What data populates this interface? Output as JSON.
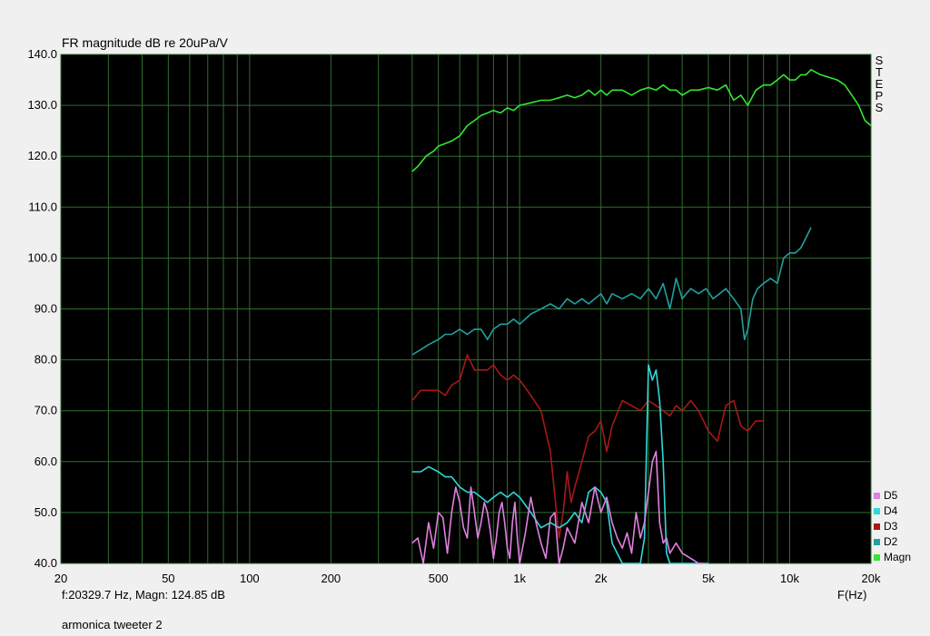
{
  "window": {
    "background": "#f0f0f0"
  },
  "header": {
    "steps_text": "STEPS"
  },
  "status": {
    "cursor_readout": "f:20329.7 Hz, Magn: 124.85 dB",
    "footer_label": "armonica tweeter 2"
  },
  "chart_data": {
    "type": "line",
    "title": "FR magnitude dB re 20uPa/V",
    "xlabel": "F(Hz)",
    "ylabel": "",
    "x_scale": "log",
    "xlim": [
      20,
      20000
    ],
    "ylim": [
      40,
      140
    ],
    "grid": true,
    "legend_placement": "bottom-right",
    "colors": {
      "plot_bg": "#000000",
      "grid": "#2f6e2f",
      "frame": "#3a7a3a"
    },
    "x_ticks": [
      {
        "v": 20,
        "label": "20"
      },
      {
        "v": 50,
        "label": "50"
      },
      {
        "v": 100,
        "label": "100"
      },
      {
        "v": 200,
        "label": "200"
      },
      {
        "v": 500,
        "label": "500"
      },
      {
        "v": 1000,
        "label": "1k"
      },
      {
        "v": 2000,
        "label": "2k"
      },
      {
        "v": 5000,
        "label": "5k"
      },
      {
        "v": 10000,
        "label": "10k"
      },
      {
        "v": 20000,
        "label": "20k"
      }
    ],
    "y_ticks": [
      {
        "v": 140,
        "label": "140.0"
      },
      {
        "v": 130,
        "label": "130.0"
      },
      {
        "v": 120,
        "label": "120.0"
      },
      {
        "v": 110,
        "label": "110.0"
      },
      {
        "v": 100,
        "label": "100.0"
      },
      {
        "v": 90,
        "label": "90.0"
      },
      {
        "v": 80,
        "label": "80.0"
      },
      {
        "v": 70,
        "label": "70.0"
      },
      {
        "v": 60,
        "label": "60.0"
      },
      {
        "v": 50,
        "label": "50.0"
      },
      {
        "v": 40,
        "label": "40.0"
      }
    ],
    "series": [
      {
        "name": "Magn",
        "color": "#33e633",
        "x": [
          400,
          420,
          450,
          480,
          500,
          530,
          560,
          600,
          640,
          680,
          720,
          760,
          800,
          850,
          900,
          950,
          1000,
          1100,
          1200,
          1300,
          1400,
          1500,
          1600,
          1700,
          1800,
          1900,
          2000,
          2100,
          2200,
          2400,
          2600,
          2800,
          3000,
          3200,
          3400,
          3600,
          3800,
          4000,
          4300,
          4600,
          5000,
          5400,
          5800,
          6200,
          6600,
          7000,
          7500,
          8000,
          8500,
          9000,
          9500,
          10000,
          10500,
          11000,
          11500,
          12000,
          13000,
          14000,
          15000,
          16000,
          17000,
          18000,
          19000,
          20000
        ],
        "y": [
          117,
          118,
          120,
          121,
          122,
          122.5,
          123,
          124,
          126,
          127,
          128,
          128.5,
          129,
          128.5,
          129.5,
          129,
          130,
          130.5,
          131,
          131,
          131.5,
          132,
          131.5,
          132,
          133,
          132,
          133,
          132,
          133,
          133,
          132,
          133,
          133.5,
          133,
          134,
          133,
          133,
          132,
          133,
          133,
          133.5,
          133,
          134,
          131,
          132,
          130,
          133,
          134,
          134,
          135,
          136,
          135,
          135,
          136,
          136,
          137,
          136,
          135.5,
          135,
          134,
          132,
          130,
          127,
          126
        ]
      },
      {
        "name": "D2",
        "color": "#22a0a0",
        "x": [
          400,
          430,
          460,
          500,
          530,
          560,
          600,
          640,
          680,
          720,
          760,
          800,
          850,
          900,
          950,
          1000,
          1100,
          1200,
          1300,
          1400,
          1500,
          1600,
          1700,
          1800,
          1900,
          2000,
          2100,
          2200,
          2400,
          2600,
          2800,
          3000,
          3200,
          3400,
          3600,
          3800,
          4000,
          4300,
          4600,
          4900,
          5200,
          5500,
          5800,
          6200,
          6600,
          6800,
          7000,
          7300,
          7600,
          8000,
          8500,
          9000,
          9500,
          10000,
          10500,
          11000,
          11500,
          12000
        ],
        "y": [
          81,
          82,
          83,
          84,
          85,
          85,
          86,
          85,
          86,
          86,
          84,
          86,
          87,
          87,
          88,
          87,
          89,
          90,
          91,
          90,
          92,
          91,
          92,
          91,
          92,
          93,
          91,
          93,
          92,
          93,
          92,
          94,
          92,
          95,
          90,
          96,
          92,
          94,
          93,
          94,
          92,
          93,
          94,
          92,
          90,
          84,
          86,
          92,
          94,
          95,
          96,
          95,
          100,
          101,
          101,
          102,
          104,
          106
        ]
      },
      {
        "name": "D3",
        "color": "#a81818",
        "x": [
          400,
          430,
          460,
          500,
          530,
          560,
          600,
          640,
          680,
          720,
          760,
          800,
          850,
          900,
          950,
          1000,
          1100,
          1200,
          1300,
          1400,
          1450,
          1500,
          1550,
          1600,
          1700,
          1800,
          1900,
          2000,
          2100,
          2200,
          2400,
          2600,
          2800,
          3000,
          3200,
          3400,
          3600,
          3800,
          4000,
          4300,
          4600,
          5000,
          5400,
          5800,
          6200,
          6600,
          7000,
          7500,
          8000
        ],
        "y": [
          72,
          74,
          74,
          74,
          73,
          75,
          76,
          81,
          78,
          78,
          78,
          79,
          77,
          76,
          77,
          76,
          73,
          70,
          62,
          45,
          50,
          58,
          52,
          55,
          60,
          65,
          66,
          68,
          62,
          67,
          72,
          71,
          70,
          72,
          71,
          70,
          69,
          71,
          70,
          72,
          70,
          66,
          64,
          71,
          72,
          67,
          66,
          68,
          68
        ]
      },
      {
        "name": "D4",
        "color": "#30d8d8",
        "x": [
          400,
          430,
          460,
          500,
          530,
          560,
          600,
          640,
          680,
          720,
          760,
          800,
          850,
          900,
          950,
          1000,
          1100,
          1200,
          1300,
          1400,
          1500,
          1600,
          1700,
          1800,
          1900,
          2000,
          2100,
          2200,
          2400,
          2600,
          2800,
          2900,
          3000,
          3100,
          3200,
          3300,
          3400,
          3500,
          3600,
          3800,
          4000,
          4300,
          4600,
          5000
        ],
        "y": [
          58,
          58,
          59,
          58,
          57,
          57,
          55,
          54,
          54,
          53,
          52,
          53,
          54,
          53,
          54,
          53,
          50,
          47,
          48,
          47,
          48,
          50,
          48,
          54,
          55,
          54,
          52,
          44,
          40,
          40,
          40,
          45,
          79,
          76,
          78,
          72,
          60,
          42,
          40,
          40,
          40,
          40,
          40,
          40
        ]
      },
      {
        "name": "D5",
        "color": "#e080e0",
        "x": [
          400,
          420,
          440,
          460,
          480,
          500,
          520,
          540,
          560,
          580,
          600,
          620,
          640,
          660,
          680,
          700,
          720,
          740,
          760,
          780,
          800,
          820,
          840,
          860,
          880,
          900,
          920,
          940,
          960,
          980,
          1000,
          1050,
          1100,
          1150,
          1200,
          1250,
          1300,
          1350,
          1400,
          1450,
          1500,
          1600,
          1700,
          1800,
          1900,
          2000,
          2100,
          2200,
          2300,
          2400,
          2500,
          2600,
          2700,
          2800,
          2900,
          3000,
          3100,
          3200,
          3300,
          3400,
          3500,
          3600,
          3800,
          4000,
          4300,
          4600,
          4800
        ],
        "y": [
          44,
          45,
          40,
          48,
          43,
          50,
          49,
          42,
          50,
          55,
          52,
          47,
          45,
          55,
          50,
          45,
          48,
          52,
          50,
          46,
          41,
          45,
          50,
          52,
          48,
          43,
          41,
          48,
          52,
          45,
          40,
          46,
          53,
          48,
          44,
          41,
          49,
          50,
          40,
          43,
          47,
          44,
          52,
          48,
          55,
          50,
          53,
          48,
          45,
          43,
          46,
          42,
          50,
          45,
          48,
          54,
          60,
          62,
          48,
          44,
          45,
          42,
          44,
          42,
          41,
          40,
          40
        ]
      }
    ]
  }
}
